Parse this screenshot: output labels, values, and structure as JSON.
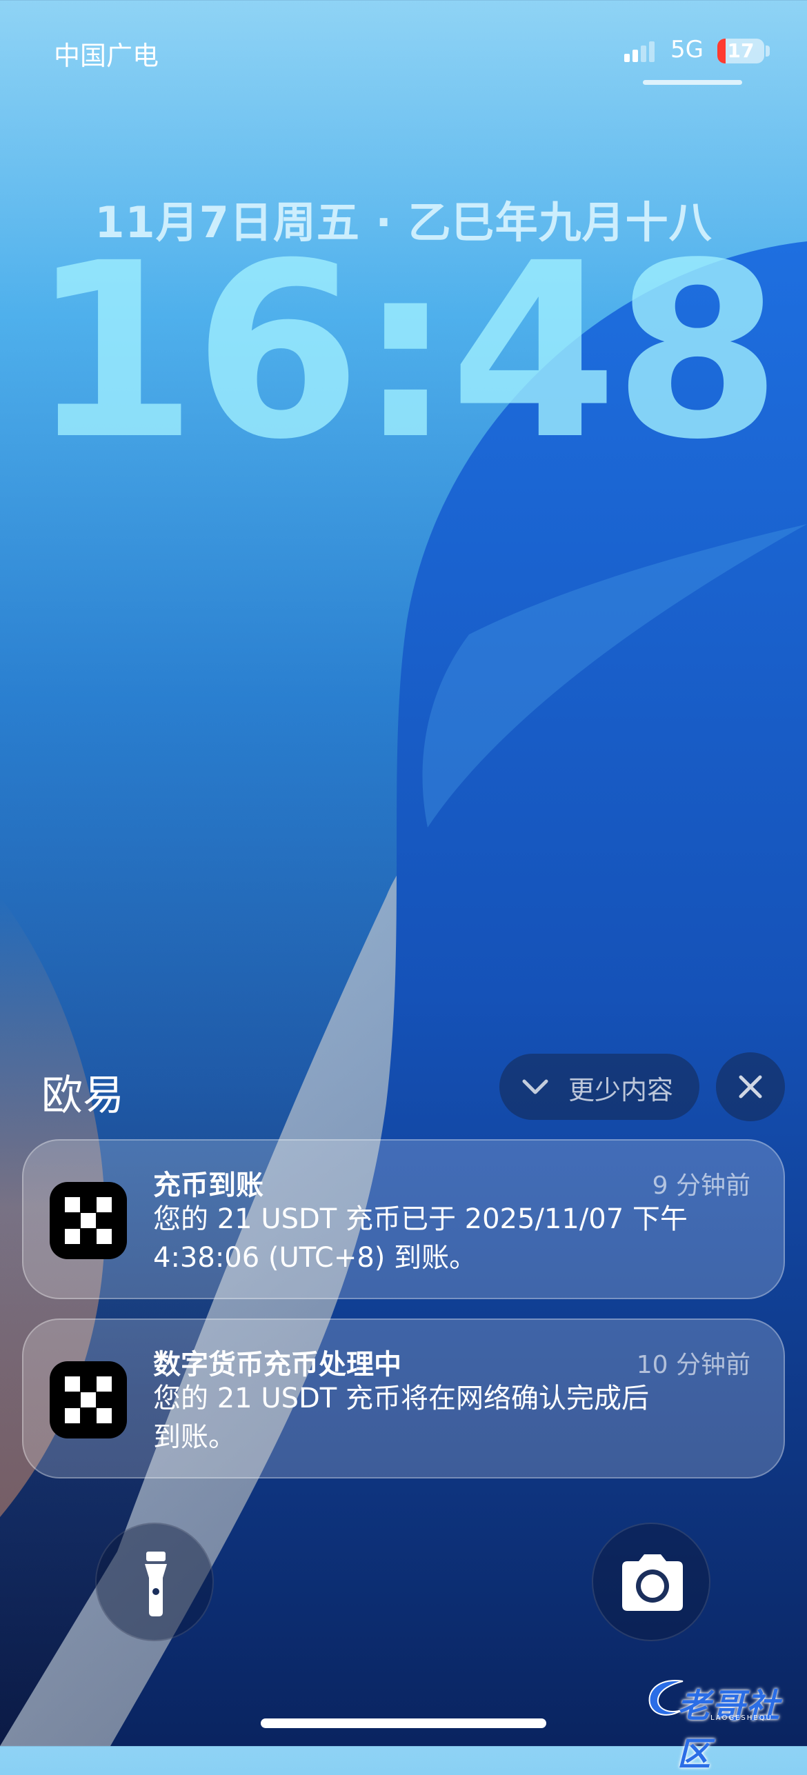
{
  "status_bar": {
    "carrier": "中国广电",
    "network": "5G",
    "battery_level": "17",
    "battery_fraction": 0.17,
    "signal_icon": "signal-bars-icon"
  },
  "lock_screen": {
    "date": "11月7日周五 · 乙巳年九月十八",
    "time": "16:48"
  },
  "notification_group": {
    "app_name": "欧易",
    "show_less_label": "更少内容",
    "notifications": [
      {
        "title": "充币到账",
        "time": "9 分钟前",
        "body_line1": "您的 21 USDT 充币已于 2025/11/07 下午",
        "body_line2": "4:38:06 (UTC+8) 到账。",
        "icon": "okx-app-icon"
      },
      {
        "title": "数字货币充币处理中",
        "time": "10 分钟前",
        "body_line1": "您的 21 USDT 充币将在网络确认完成后",
        "body_line2": "到账。",
        "icon": "okx-app-icon"
      }
    ]
  },
  "quick_actions": {
    "left_icon": "flashlight-icon",
    "right_icon": "camera-icon"
  },
  "watermark": {
    "text": "老哥社区",
    "subtext": "LAOGESHEQU"
  },
  "colors": {
    "accent_blue": "#2a7fd0",
    "battery_low": "#ff3b30",
    "clock_tint": "#a0f0ff"
  }
}
